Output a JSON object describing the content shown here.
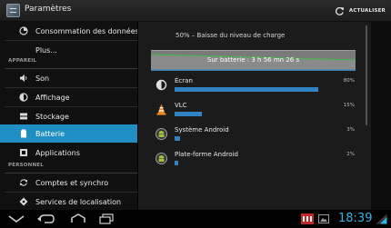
{
  "app": {
    "title": "Paramètres"
  },
  "toolbar": {
    "refresh_label": "ACTUALISER"
  },
  "menu": {
    "data_usage": "Consommation des données",
    "more": "Plus...",
    "section_device": "APPAREIL",
    "sound": "Son",
    "display": "Affichage",
    "storage": "Stockage",
    "battery": "Batterie",
    "apps": "Applications",
    "section_personal": "PERSONNEL",
    "accounts": "Comptes et synchro",
    "location": "Services de localisation"
  },
  "battery": {
    "summary": "50% – Baisse du niveau de charge",
    "graph_label": "Sur batterie : 3 h 56 mn 26 s",
    "level": 0.5,
    "usage": [
      {
        "name": "Écran",
        "percent_label": "80%",
        "value": 80,
        "icon": "display-brightness-icon"
      },
      {
        "name": "VLC",
        "percent_label": "15%",
        "value": 15,
        "icon": "vlc-cone-icon"
      },
      {
        "name": "Système Android",
        "percent_label": "3%",
        "value": 3,
        "icon": "android-system-icon"
      },
      {
        "name": "Plate-forme Android",
        "percent_label": "2%",
        "value": 2,
        "icon": "android-platform-icon"
      }
    ]
  },
  "statusbar": {
    "time": "18:39",
    "accent": "#33b5e5"
  },
  "colors": {
    "accent": "#1f8fc3",
    "bar": "#2f84c5"
  }
}
